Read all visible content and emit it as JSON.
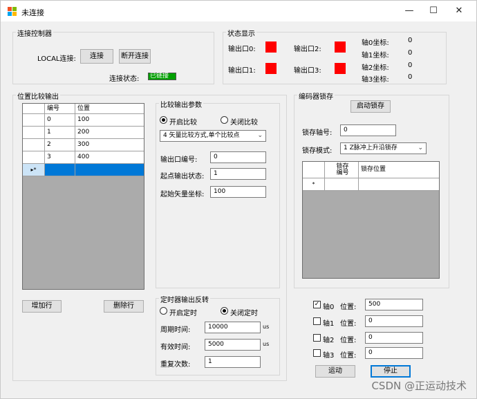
{
  "window": {
    "title": "未连接",
    "icon": "app-icon",
    "minimize": "—",
    "maximize": "☐",
    "close": "✕"
  },
  "connect": {
    "group_label": "连接控制器",
    "local_label": "LOCAL连接:",
    "connect_btn": "连接",
    "disconnect_btn": "断开连接",
    "status_label": "连接状态:",
    "status_value": "已链接",
    "status_color": "#00a000"
  },
  "status": {
    "group_label": "状态显示",
    "outputs": [
      "输出口0:",
      "输出口2:",
      "输出口1:",
      "输出口3:"
    ],
    "output_color": "#ff0000",
    "axes": [
      {
        "label": "轴0坐标:",
        "value": "0"
      },
      {
        "label": "轴1坐标:",
        "value": "0"
      },
      {
        "label": "轴2坐标:",
        "value": "0"
      },
      {
        "label": "轴3坐标:",
        "value": "0"
      }
    ]
  },
  "position_compare": {
    "group_label": "位置比较输出",
    "columns": [
      "编号",
      "位置"
    ],
    "rows": [
      {
        "id": "0",
        "pos": "100"
      },
      {
        "id": "1",
        "pos": "200"
      },
      {
        "id": "2",
        "pos": "300"
      },
      {
        "id": "3",
        "pos": "400"
      }
    ],
    "new_row_marker": "▸*",
    "add_row_btn": "增加行",
    "delete_row_btn": "删除行"
  },
  "compare_params": {
    "group_label": "比较输出参数",
    "radio_on": "开启比较",
    "radio_off": "关闭比较",
    "mode": "4 矢量比较方式,单个比较点",
    "port_label": "输出口编号:",
    "port_value": "0",
    "start_state_label": "起点输出状态:",
    "start_state_value": "1",
    "start_coord_label": "起始矢量坐标:",
    "start_coord_value": "100"
  },
  "timer": {
    "group_label": "定时器输出反转",
    "radio_on": "开启定时",
    "radio_off": "关闭定时",
    "period_label": "周期时间:",
    "period_value": "10000",
    "period_unit": "us",
    "valid_label": "有效时间:",
    "valid_value": "5000",
    "valid_unit": "us",
    "repeat_label": "重复次数:",
    "repeat_value": "1"
  },
  "encoder": {
    "group_label": "编码器锁存",
    "start_btn": "启动锁存",
    "axis_label": "锁存轴号:",
    "axis_value": "0",
    "mode_label": "锁存模式:",
    "mode_value": "1 Z脉冲上升沿锁存",
    "col1_line1": "锁存",
    "col1_line2": "编号",
    "col2": "锁存位置",
    "new_row_marker": "*"
  },
  "motion": {
    "axes": [
      {
        "label": "轴0",
        "checked": true,
        "pos_label": "位置:",
        "value": "500"
      },
      {
        "label": "轴1",
        "checked": false,
        "pos_label": "位置:",
        "value": "0"
      },
      {
        "label": "轴2",
        "checked": false,
        "pos_label": "位置:",
        "value": "0"
      },
      {
        "label": "轴3",
        "checked": false,
        "pos_label": "位置:",
        "value": "0"
      }
    ],
    "run_btn": "运动",
    "stop_btn": "停止"
  },
  "watermark": "CSDN @正运动技术"
}
